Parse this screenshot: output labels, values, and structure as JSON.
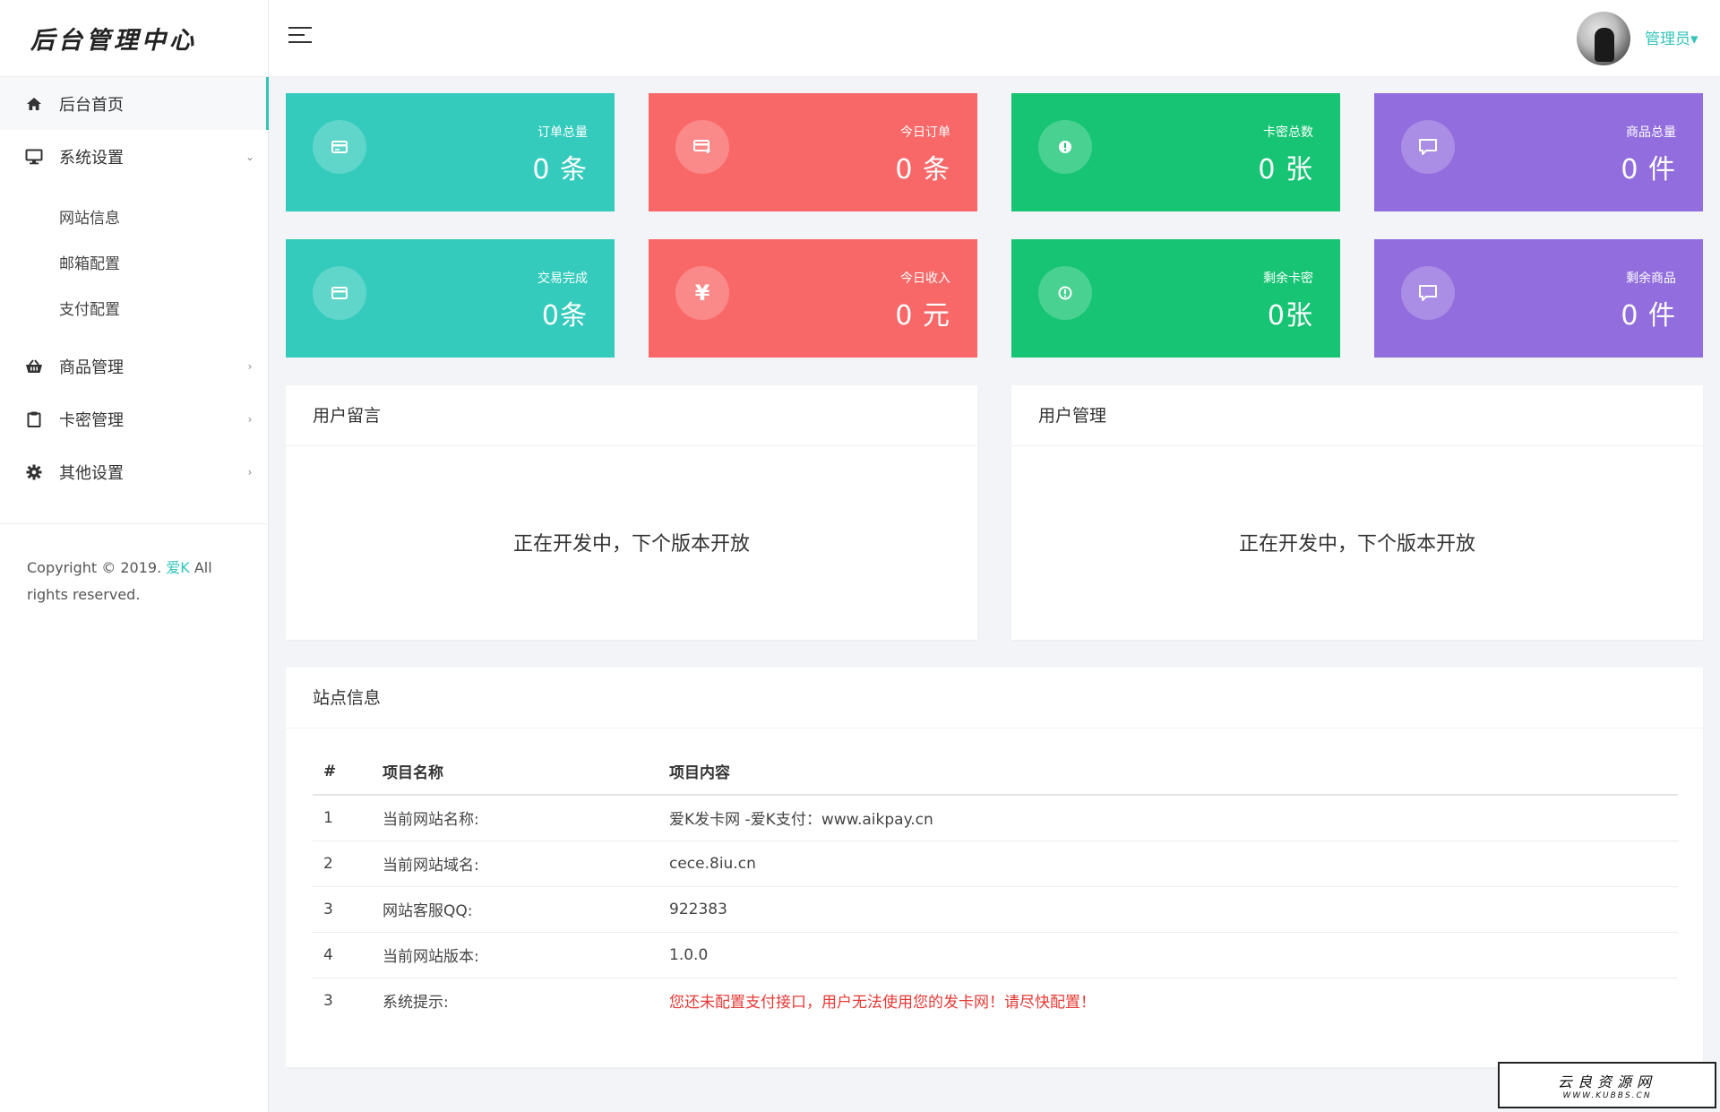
{
  "sidebar": {
    "brand": "后台管理中心",
    "items": [
      {
        "label": "后台首页",
        "icon": "home-icon",
        "active": true
      },
      {
        "label": "系统设置",
        "icon": "monitor-icon",
        "arrow": "⌄"
      },
      {
        "label": "商品管理",
        "icon": "basket-icon",
        "arrow": "›"
      },
      {
        "label": "卡密管理",
        "icon": "clipboard-icon",
        "arrow": "›"
      },
      {
        "label": "其他设置",
        "icon": "gear-icon",
        "arrow": "›"
      }
    ],
    "sub_items": [
      "网站信息",
      "邮箱配置",
      "支付配置"
    ],
    "copyright_prefix": "Copyright © 2019. ",
    "copyright_brand": "爱K",
    "copyright_suffix": " All rights reserved."
  },
  "header": {
    "user_name": "管理员▾"
  },
  "stats": [
    {
      "label": "订单总量",
      "value": "0 条",
      "color": "#34cbbd",
      "icon": "card-icon"
    },
    {
      "label": "今日订单",
      "value": "0 条",
      "color": "#f96868",
      "icon": "card-add-icon"
    },
    {
      "label": "卡密总数",
      "value": "0 张",
      "color": "#17c474",
      "icon": "info-icon"
    },
    {
      "label": "商品总量",
      "value": "0 件",
      "color": "#926dde",
      "icon": "message-icon"
    },
    {
      "label": "交易完成",
      "value": "0条",
      "color": "#34cbbd",
      "icon": "card-icon"
    },
    {
      "label": "今日收入",
      "value": "0 元",
      "color": "#f96868",
      "icon": "yen-icon"
    },
    {
      "label": "剩余卡密",
      "value": "0张",
      "color": "#17c474",
      "icon": "info-icon"
    },
    {
      "label": "剩余商品",
      "value": "0 件",
      "color": "#926dde",
      "icon": "message-icon"
    }
  ],
  "panels": {
    "messages": {
      "title": "用户留言",
      "body": "正在开发中，下个版本开放"
    },
    "users": {
      "title": "用户管理",
      "body": "正在开发中，下个版本开放"
    }
  },
  "site_info": {
    "title": "站点信息",
    "headers": [
      "#",
      "项目名称",
      "项目内容"
    ],
    "rows": [
      {
        "num": "1",
        "name": "当前网站名称:",
        "value": "爱K发卡网 -爱K支付：www.aikpay.cn"
      },
      {
        "num": "2",
        "name": "当前网站域名:",
        "value": "cece.8iu.cn"
      },
      {
        "num": "3",
        "name": "网站客服QQ:",
        "value": "922383"
      },
      {
        "num": "4",
        "name": "当前网站版本:",
        "value": "1.0.0"
      },
      {
        "num": "3",
        "name": "系统提示:",
        "value": "您还未配置支付接口，用户无法使用您的发卡网！请尽快配置！",
        "warning": true
      }
    ]
  },
  "watermark": {
    "title": "云良资源网",
    "url": "WWW.KUBBS.CN"
  }
}
